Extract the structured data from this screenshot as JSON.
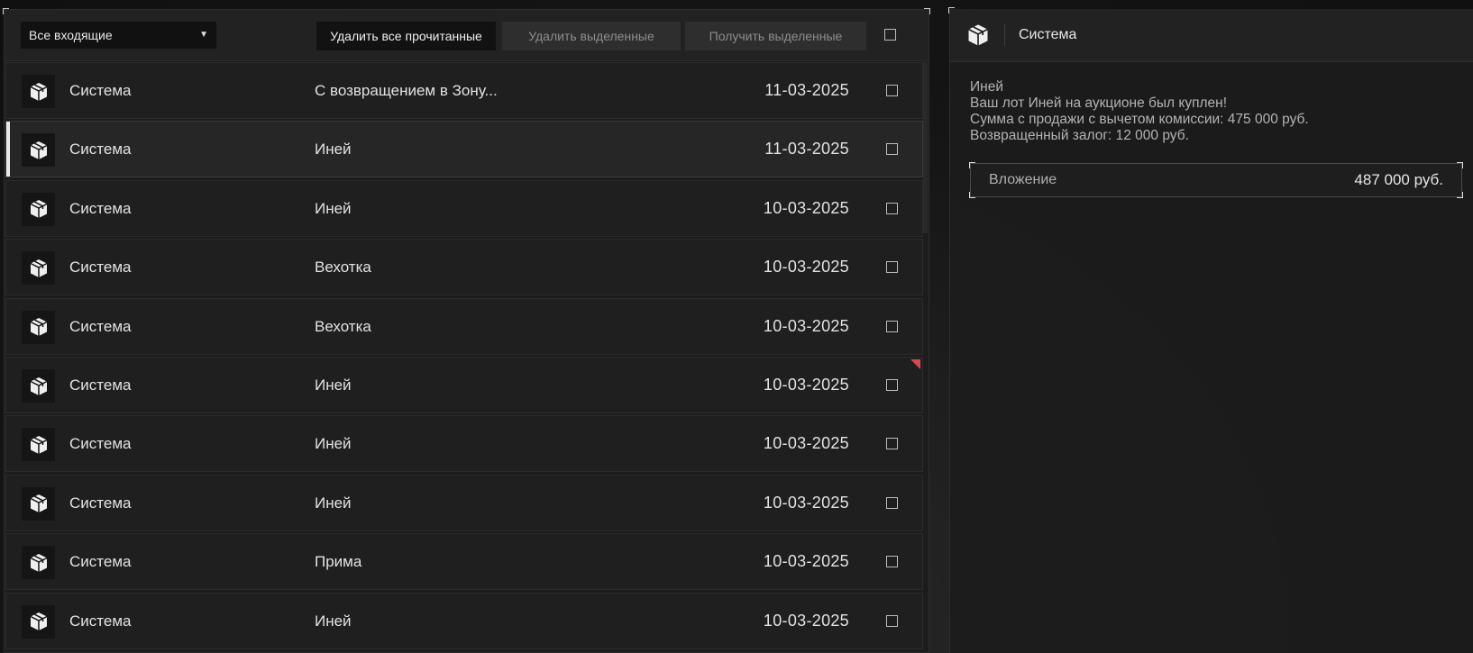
{
  "toolbar": {
    "filter_value": "Все входящие",
    "delete_read_label": "Удалить все прочитанные",
    "delete_selected_label": "Удалить выделенные",
    "receive_selected_label": "Получить выделенные"
  },
  "messages": [
    {
      "sender": "Система",
      "subject": "С возвращением в Зону...",
      "date": "11-03-2025",
      "selected": false,
      "flag": false
    },
    {
      "sender": "Система",
      "subject": "Иней",
      "date": "11-03-2025",
      "selected": true,
      "flag": false
    },
    {
      "sender": "Система",
      "subject": "Иней",
      "date": "10-03-2025",
      "selected": false,
      "flag": false
    },
    {
      "sender": "Система",
      "subject": "Вехотка",
      "date": "10-03-2025",
      "selected": false,
      "flag": false
    },
    {
      "sender": "Система",
      "subject": "Вехотка",
      "date": "10-03-2025",
      "selected": false,
      "flag": false
    },
    {
      "sender": "Система",
      "subject": "Иней",
      "date": "10-03-2025",
      "selected": false,
      "flag": true
    },
    {
      "sender": "Система",
      "subject": "Иней",
      "date": "10-03-2025",
      "selected": false,
      "flag": false
    },
    {
      "sender": "Система",
      "subject": "Иней",
      "date": "10-03-2025",
      "selected": false,
      "flag": false
    },
    {
      "sender": "Система",
      "subject": "Прима",
      "date": "10-03-2025",
      "selected": false,
      "flag": false
    },
    {
      "sender": "Система",
      "subject": "Иней",
      "date": "10-03-2025",
      "selected": false,
      "flag": false
    }
  ],
  "detail": {
    "sender": "Система",
    "body": [
      "Иней",
      "Ваш лот Иней на аукционе был куплен!",
      "Сумма с продажи с вычетом комиссии: 475 000 руб.",
      "Возвращенный залог: 12 000 руб."
    ],
    "attachment_label": "Вложение",
    "attachment_amount": "487 000 руб."
  },
  "icons": {
    "avatar": "package-box-icon",
    "flag": "new-indicator-icon",
    "dropdown": "caret-down-icon"
  },
  "colors": {
    "flag": "#d8484f",
    "selected_marker": "#e8e8e8"
  }
}
